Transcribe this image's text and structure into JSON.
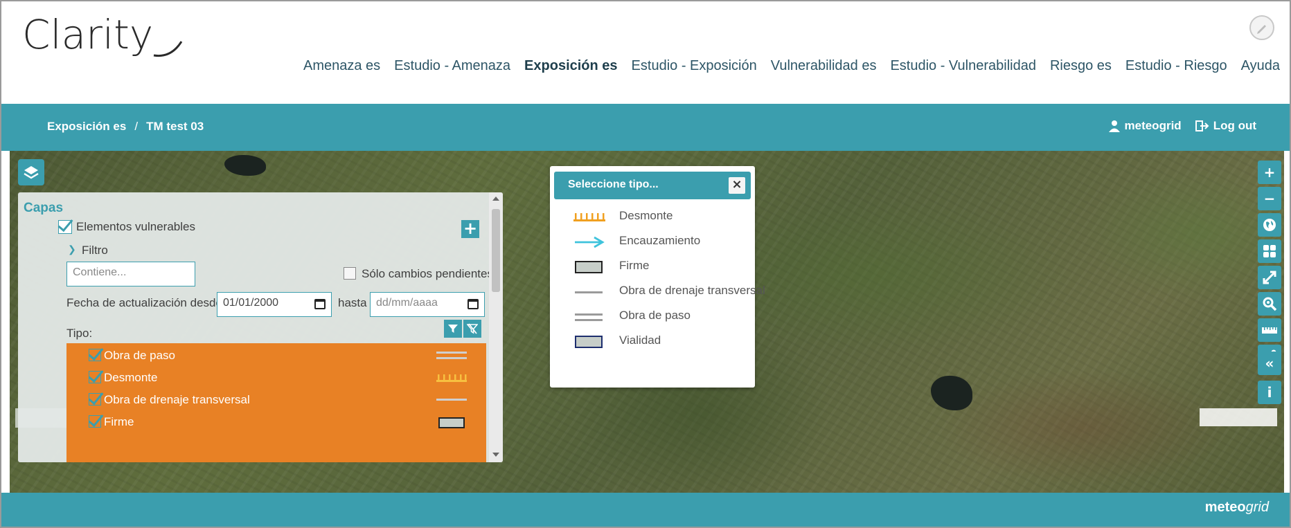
{
  "app": {
    "logo_text": "Clarity"
  },
  "nav": {
    "items": [
      {
        "label": "Amenaza es",
        "active": false
      },
      {
        "label": "Estudio - Amenaza",
        "active": false
      },
      {
        "label": "Exposición es",
        "active": true
      },
      {
        "label": "Estudio - Exposición",
        "active": false
      },
      {
        "label": "Vulnerabilidad es",
        "active": false
      },
      {
        "label": "Estudio - Vulnerabilidad",
        "active": false
      },
      {
        "label": "Riesgo es",
        "active": false
      },
      {
        "label": "Estudio - Riesgo",
        "active": false
      },
      {
        "label": "Ayuda",
        "active": false
      }
    ]
  },
  "breadcrumb": {
    "parent": "Exposición es",
    "separator": "/",
    "current": "TM test 03"
  },
  "user": {
    "name": "meteogrid",
    "logout": "Log out"
  },
  "panel": {
    "title": "Capas",
    "layer_name": "Elementos vulnerables",
    "filter_label": "Filtro",
    "search_placeholder": "Contiene...",
    "only_pending": "Sólo cambios pendientes",
    "date_from_label": "Fecha de actualización desde",
    "date_from_value": "01/01/2000",
    "date_to_label": "hasta",
    "date_to_placeholder": "dd/mm/aaaa",
    "type_label": "Tipo:",
    "types": [
      {
        "label": "Obra de paso",
        "symbol": "double-line"
      },
      {
        "label": "Desmonte",
        "symbol": "comb"
      },
      {
        "label": "Obra de drenaje transversal",
        "symbol": "single-line"
      },
      {
        "label": "Firme",
        "symbol": "box"
      }
    ]
  },
  "popup": {
    "title": "Seleccione tipo...",
    "options": [
      {
        "label": "Desmonte",
        "symbol": "comb"
      },
      {
        "label": "Encauzamiento",
        "symbol": "arrow"
      },
      {
        "label": "Firme",
        "symbol": "box"
      },
      {
        "label": "Obra de drenaje transversal",
        "symbol": "single-line"
      },
      {
        "label": "Obra de paso",
        "symbol": "double-line"
      },
      {
        "label": "Vialidad",
        "symbol": "box-blue"
      }
    ]
  },
  "toolbar": {
    "zoom_in": "+",
    "zoom_out": "−",
    "collapse": "«",
    "info": "i"
  },
  "footer": {
    "brand_a": "meteo",
    "brand_b": "grid"
  },
  "colors": {
    "accent": "#3b9eae",
    "type_highlight": "#e88125",
    "desmonte_symbol": "#f0a020",
    "encauzamiento_symbol": "#3fc3dc"
  }
}
